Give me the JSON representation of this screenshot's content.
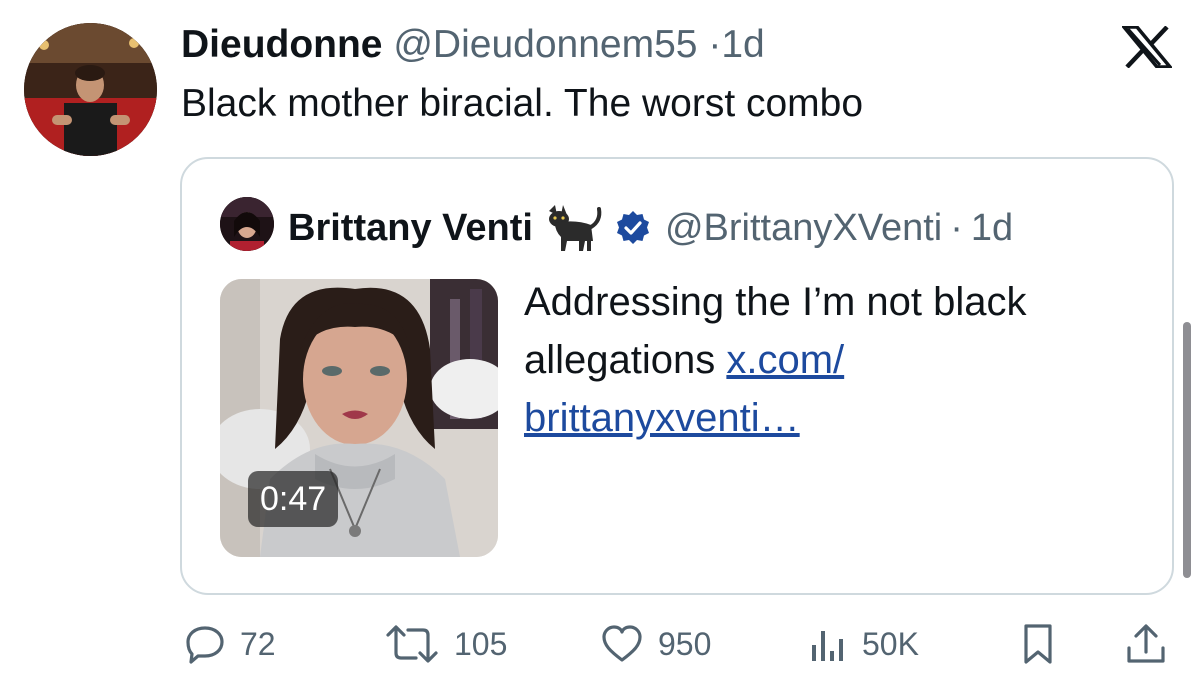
{
  "tweet": {
    "display_name": "Dieudonne",
    "handle": "@Dieudonnem55",
    "separator": "·",
    "time": "1d",
    "text": "Black mother biracial. The worst combo"
  },
  "quote": {
    "display_name": "Brittany Venti",
    "handle": "@BrittanyXVenti",
    "separator": "·",
    "time": "1d",
    "text": "Addressing the I’m not black allegations",
    "link_line1": "x.com/",
    "link_line2": "brittanyxventi…",
    "video_duration": "0:47",
    "icons": [
      "black-cat-emoji",
      "verified-badge"
    ]
  },
  "actions": {
    "reply_count": "72",
    "retweet_count": "105",
    "like_count": "950",
    "views_count": "50K"
  },
  "colors": {
    "text": "#0f1419",
    "muted": "#536471",
    "border": "#cfd9de",
    "verified": "#1d4a9e",
    "link": "#1d4a9e"
  }
}
